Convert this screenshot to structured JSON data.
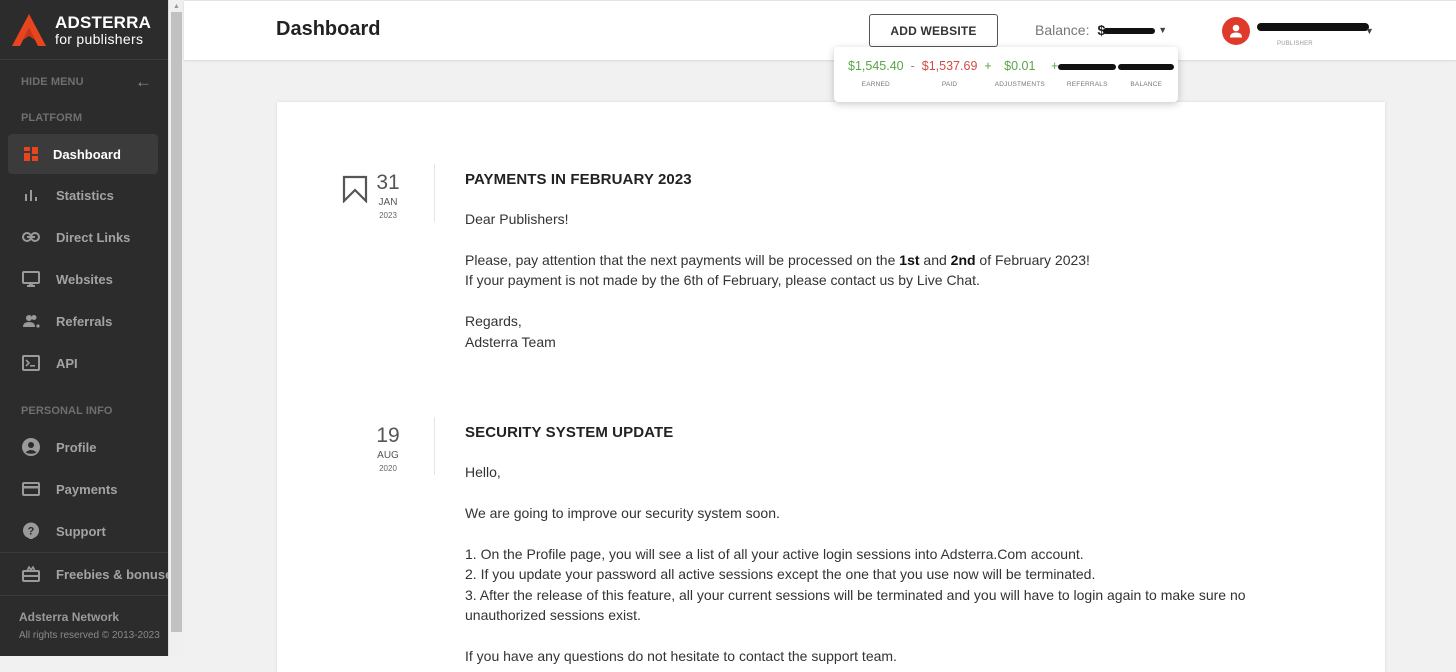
{
  "brand": {
    "name": "ADSTERRA",
    "tagline": "for publishers",
    "accent": "#e8451e"
  },
  "sidebar": {
    "hide_menu_label": "HIDE MENU",
    "platform_label": "PLATFORM",
    "platform_items": [
      {
        "label": "Dashboard",
        "icon": "dashboard-icon",
        "active": true
      },
      {
        "label": "Statistics",
        "icon": "bar-chart-icon"
      },
      {
        "label": "Direct Links",
        "icon": "link-icon"
      },
      {
        "label": "Websites",
        "icon": "monitor-icon"
      },
      {
        "label": "Referrals",
        "icon": "people-icon"
      },
      {
        "label": "API",
        "icon": "terminal-icon"
      }
    ],
    "personal_label": "PERSONAL INFO",
    "personal_items": [
      {
        "label": "Profile",
        "icon": "account-circle-icon"
      },
      {
        "label": "Payments",
        "icon": "credit-card-icon"
      },
      {
        "label": "Support",
        "icon": "help-bubble-icon"
      }
    ],
    "bonus_item": {
      "label": "Freebies & bonuses",
      "icon": "gift-box-icon"
    },
    "footer": {
      "title": "Adsterra Network",
      "copyright": "All rights reserved © 2013-2023"
    }
  },
  "header": {
    "title": "Dashboard",
    "add_website_label": "ADD WEBSITE",
    "balance_label": "Balance:",
    "balance_value_visible": "$",
    "user_role": "PUBLISHER"
  },
  "balance_breakdown": {
    "earned": {
      "value": "$1,545.40",
      "label": "EARNED",
      "color": "#5aa646"
    },
    "op1": "-",
    "paid": {
      "value": "$1,537.69",
      "label": "PAID",
      "color": "#d04b45"
    },
    "op2": "+",
    "adjustments": {
      "value": "$0.01",
      "label": "ADJUSTMENTS",
      "color": "#5aa646"
    },
    "op3": "+",
    "referrals": {
      "label": "REFERRALS"
    },
    "balance": {
      "label": "BALANCE"
    }
  },
  "news": [
    {
      "day": "31",
      "month": "JAN",
      "year": "2023",
      "title": "PAYMENTS IN FEBRUARY 2023",
      "greeting": "Dear Publishers!",
      "line1_pre": "Please, pay attention that the next payments will be processed on the ",
      "line1_b1": "1st",
      "line1_mid": " and ",
      "line1_b2": "2nd",
      "line1_post": " of February 2023!",
      "line2": "If your payment is not made by the 6th of February, please contact us by Live Chat.",
      "sign1": "Regards,",
      "sign2": "Adsterra Team"
    },
    {
      "day": "19",
      "month": "AUG",
      "year": "2020",
      "title": "SECURITY SYSTEM UPDATE",
      "greeting": "Hello,",
      "intro": "We are going to improve our security system soon.",
      "points": [
        "1. On the Profile page, you will see a list of all your active login sessions into Adsterra.Com account.",
        "2. If you update your password all active sessions except the one that you use now will be terminated.",
        "3. After the release of this feature, all your current sessions will be terminated and you will have to login again to make sure no unauthorized sessions exist."
      ],
      "closing": "If you have any questions do not hesitate to contact the support team."
    }
  ]
}
